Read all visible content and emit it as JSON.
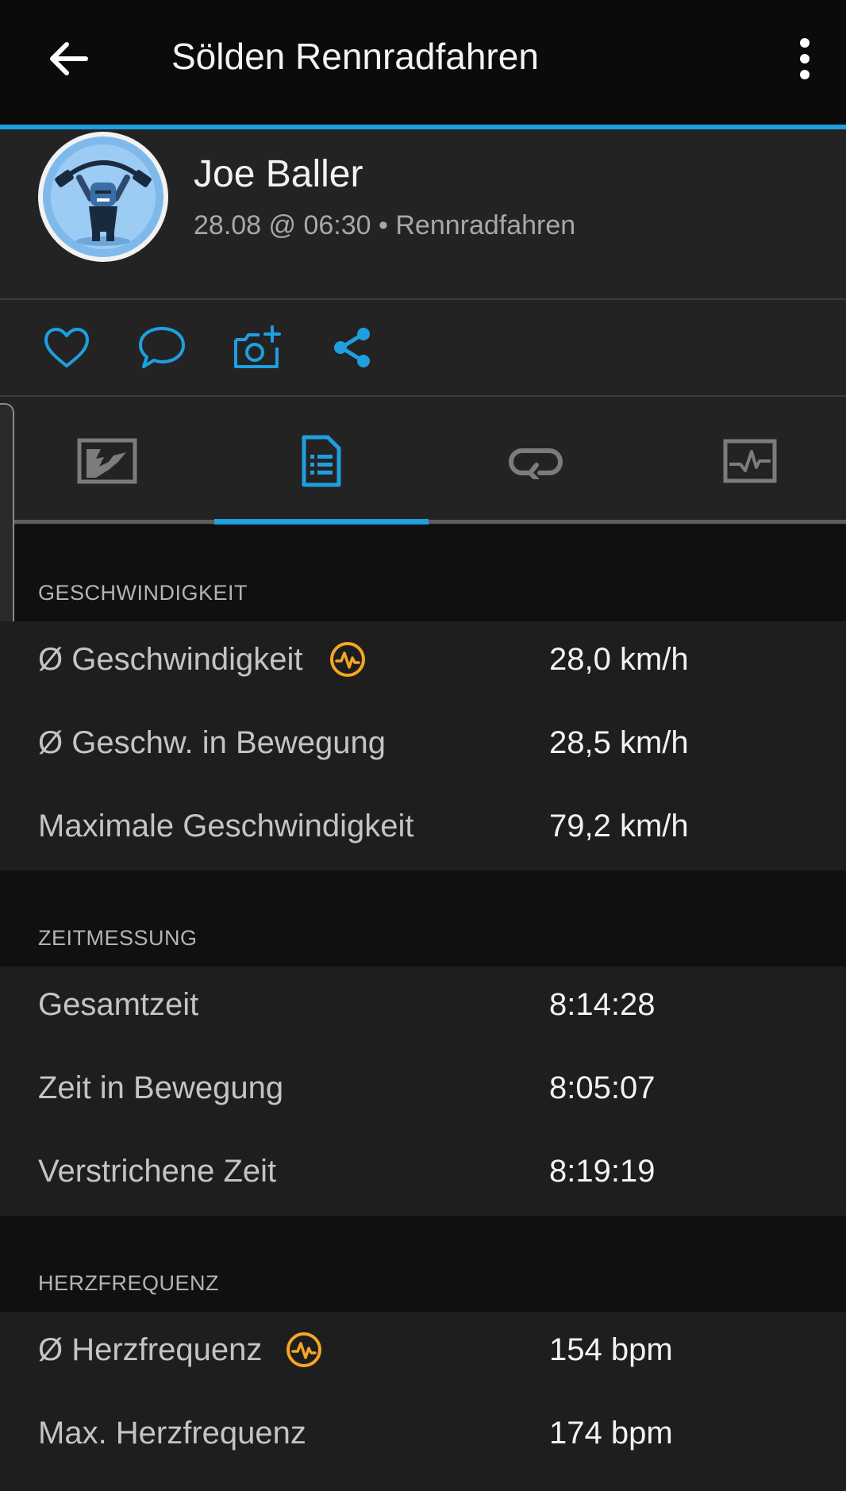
{
  "app_bar": {
    "title": "Sölden Rennradfahren",
    "back_icon": "arrow-left-icon",
    "menu_icon": "more-vertical-icon"
  },
  "profile": {
    "name": "Joe Baller",
    "meta": "28.08 @ 06:30 • Rennradfahren",
    "avatar_icon": "weightlifter-avatar"
  },
  "actions": [
    {
      "name": "like",
      "icon": "heart-icon"
    },
    {
      "name": "comment",
      "icon": "comment-icon"
    },
    {
      "name": "add-photo",
      "icon": "camera-plus-icon"
    },
    {
      "name": "share",
      "icon": "share-icon"
    }
  ],
  "tabs": [
    {
      "name": "map",
      "icon": "map-icon",
      "selected": false
    },
    {
      "name": "stats",
      "icon": "document-list-icon",
      "selected": true
    },
    {
      "name": "laps",
      "icon": "loop-icon",
      "selected": false
    },
    {
      "name": "charts",
      "icon": "chart-icon",
      "selected": false
    }
  ],
  "sections": {
    "speed": {
      "title": "GESCHWINDIGKEIT",
      "rows": [
        {
          "label": "Ø Geschwindigkeit",
          "value": "28,0 km/h",
          "badge": "heart-rate-zone-icon"
        },
        {
          "label": "Ø Geschw. in Bewegung",
          "value": "28,5 km/h"
        },
        {
          "label": "Maximale Geschwindigkeit",
          "value": "79,2 km/h"
        }
      ]
    },
    "timing": {
      "title": "ZEITMESSUNG",
      "rows": [
        {
          "label": "Gesamtzeit",
          "value": "8:14:28"
        },
        {
          "label": "Zeit in Bewegung",
          "value": "8:05:07"
        },
        {
          "label": "Verstrichene Zeit",
          "value": "8:19:19"
        }
      ]
    },
    "heart_rate": {
      "title": "HERZFREQUENZ",
      "rows": [
        {
          "label": "Ø Herzfrequenz",
          "value": "154 bpm",
          "badge": "heart-rate-zone-icon"
        },
        {
          "label": "Max. Herzfrequenz",
          "value": "174 bpm"
        }
      ]
    }
  },
  "colors": {
    "accent": "#1e9fe0",
    "badge": "#f5a623",
    "background": "#101010",
    "card": "#1e1e1e"
  }
}
